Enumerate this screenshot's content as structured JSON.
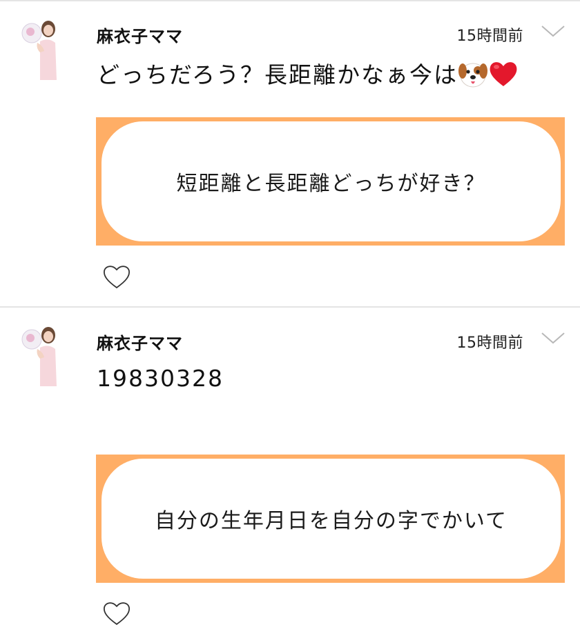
{
  "posts": [
    {
      "username": "麻衣子ママ",
      "timestamp": "15時間前",
      "body": "どっちだろう？長距離かなぁ今は",
      "emojis": [
        "dog-face",
        "red-heart"
      ],
      "question": "短距離と長距離どっちが好き？"
    },
    {
      "username": "麻衣子ママ",
      "timestamp": "15時間前",
      "body": "19830328",
      "emojis": [],
      "question": "自分の生年月日を自分の字でかいて"
    }
  ],
  "colors": {
    "question_border": "#ffae66",
    "divider": "#e4e4e4",
    "text": "#111111"
  }
}
